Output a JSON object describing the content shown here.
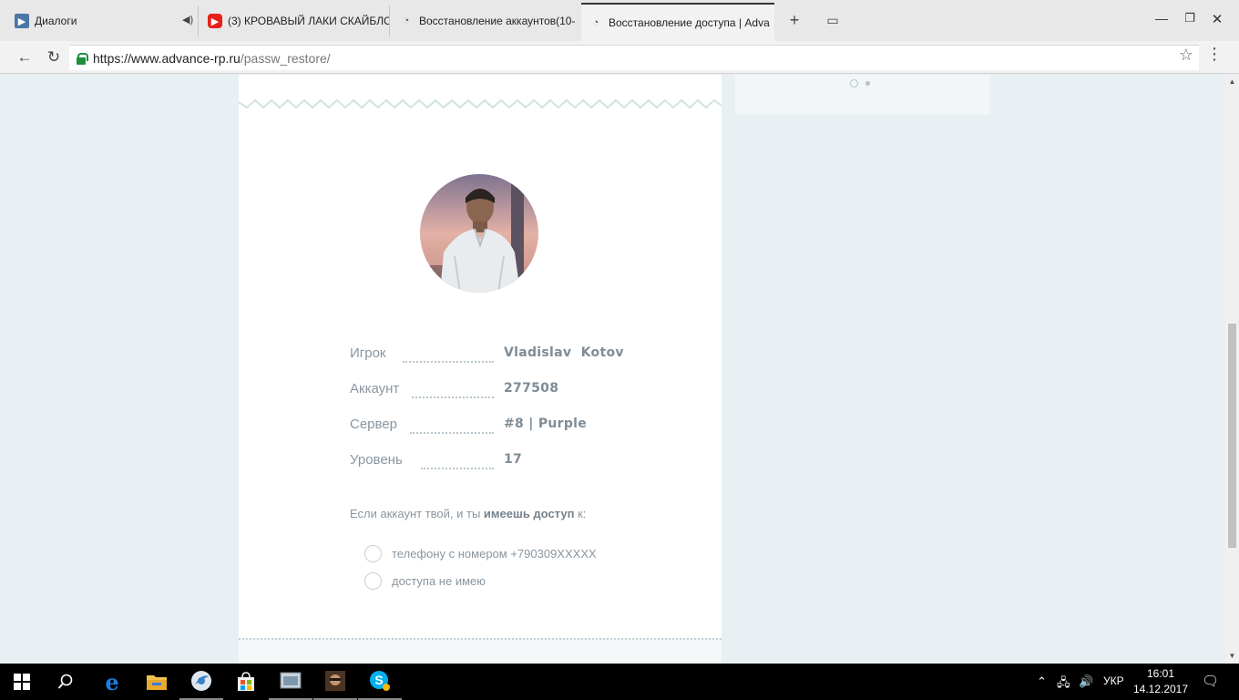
{
  "tabs": [
    {
      "label": "Диалоги",
      "icon": "vk-icon"
    },
    {
      "label": "(3) КРОВАВЫЙ ЛАКИ СКАЙБЛО",
      "icon": "youtube-icon"
    },
    {
      "label": "Восстановление аккаунтов(10-",
      "icon": "advance-icon"
    },
    {
      "label": "Восстановление доступа | Adva",
      "icon": "advance-icon"
    }
  ],
  "address_bar": {
    "url_host": "https://www.advance-rp.ru",
    "url_path": "/passw_restore/"
  },
  "player": {
    "rows": [
      {
        "key": "Игрок",
        "value": "Vladislav  Kotov"
      },
      {
        "key": "Аккаунт",
        "value": "277508"
      },
      {
        "key": "Сервер",
        "value": "#8 | Purple"
      },
      {
        "key": "Уровень",
        "value": "17"
      }
    ]
  },
  "question": {
    "prefix": "Если аккаунт твой, и ты ",
    "bold": "имеешь доступ",
    "suffix": " к:"
  },
  "options": [
    {
      "label": "телефону с номером +790309XXXXX"
    },
    {
      "label": "доступа не имею"
    }
  ],
  "taskbar": {
    "language": "УКР",
    "time": "16:01",
    "date": "14.12.2017"
  },
  "colors": {
    "page_bg": "#e9f0f3",
    "card_bg": "#ffffff",
    "muted_text": "#8a96a0",
    "secure_green": "#1e8e3e"
  }
}
